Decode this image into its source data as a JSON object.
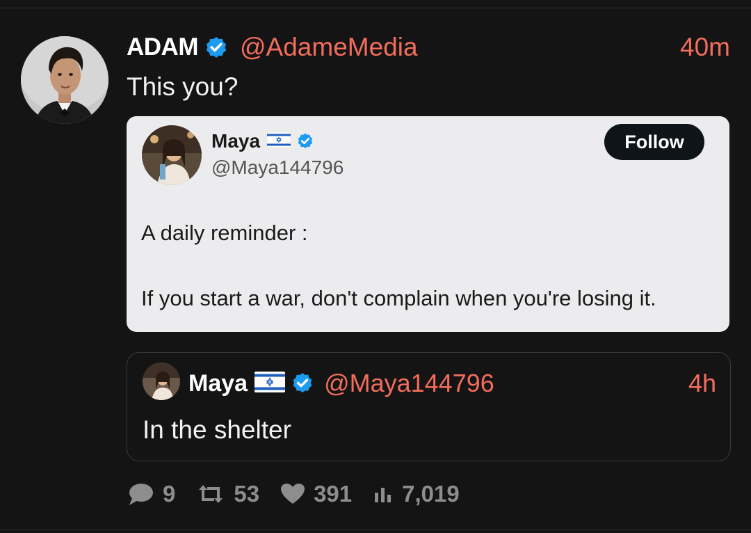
{
  "tweet": {
    "author_name": "ADAM",
    "handle": "@AdameMedia",
    "time": "40m",
    "text": "This you?"
  },
  "quote_card": {
    "name": "Maya",
    "handle": "@Maya144796",
    "follow_label": "Follow",
    "line1": "A daily reminder :",
    "line2": "If you start a war, don't complain when you're losing it."
  },
  "quoted_reply": {
    "name": "Maya",
    "handle": "@Maya144796",
    "time": "4h",
    "text": "In the shelter"
  },
  "actions": {
    "replies": "9",
    "retweets": "53",
    "likes": "391",
    "views": "7,019"
  },
  "colors": {
    "background": "#141414",
    "accent": "#f26d5b",
    "verified": "#1d9bf0",
    "card": "#ececee",
    "muted": "#8d8d8d"
  }
}
